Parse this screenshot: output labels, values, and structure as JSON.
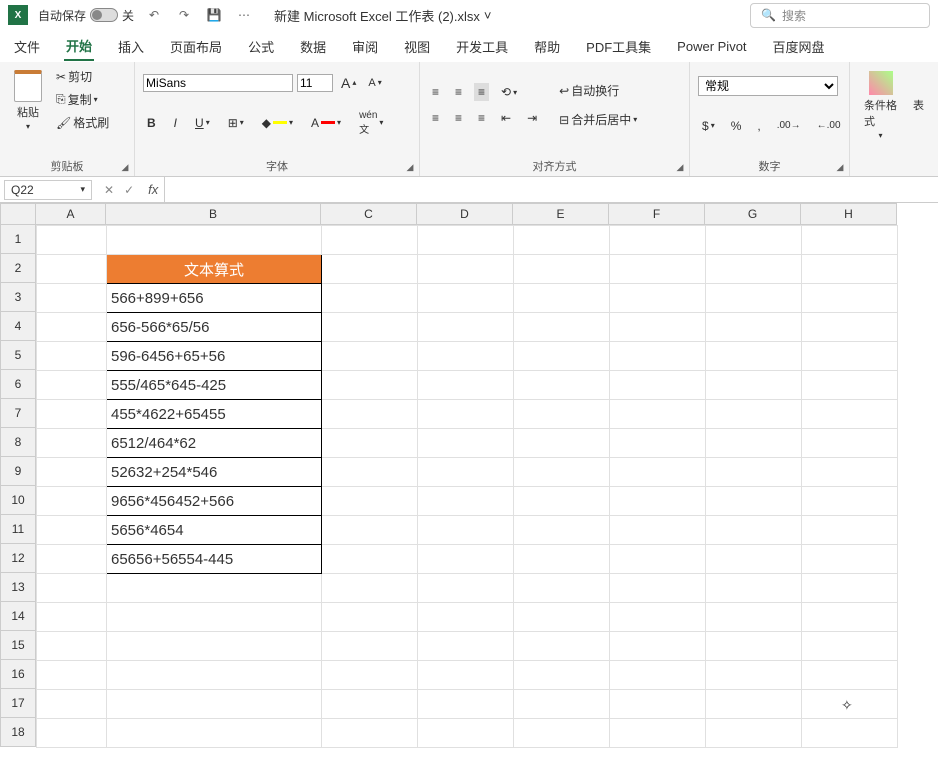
{
  "titlebar": {
    "autosave_label": "自动保存",
    "autosave_state": "关",
    "filename": "新建 Microsoft Excel 工作表 (2).xlsx",
    "search_placeholder": "搜索"
  },
  "menu": {
    "items": [
      "文件",
      "开始",
      "插入",
      "页面布局",
      "公式",
      "数据",
      "审阅",
      "视图",
      "开发工具",
      "帮助",
      "PDF工具集",
      "Power Pivot",
      "百度网盘"
    ],
    "active_index": 1
  },
  "ribbon": {
    "clipboard": {
      "paste": "粘贴",
      "cut": "剪切",
      "copy": "复制",
      "painter": "格式刷",
      "label": "剪贴板"
    },
    "font": {
      "name": "MiSans",
      "size": "11",
      "label": "字体"
    },
    "align": {
      "wrap": "自动换行",
      "merge": "合并后居中",
      "label": "对齐方式"
    },
    "number": {
      "format": "常规",
      "label": "数字"
    },
    "styles": {
      "cond": "条件格式",
      "table": "表"
    }
  },
  "namebox": "Q22",
  "formula": "",
  "columns": [
    "A",
    "B",
    "C",
    "D",
    "E",
    "F",
    "G",
    "H"
  ],
  "row_count": 18,
  "header_cell": {
    "row": 2,
    "col": "B",
    "text": "文本算式"
  },
  "data_cells": [
    "566+899+656",
    "656-566*65/56",
    "596-6456+65+56",
    "555/465*645-425",
    "455*4622+65455",
    "6512/464*62",
    "52632+254*546",
    "9656*456452+566",
    "5656*4654",
    "65656+56554-445"
  ],
  "cursor_pos": {
    "row": 17,
    "col": "H"
  }
}
